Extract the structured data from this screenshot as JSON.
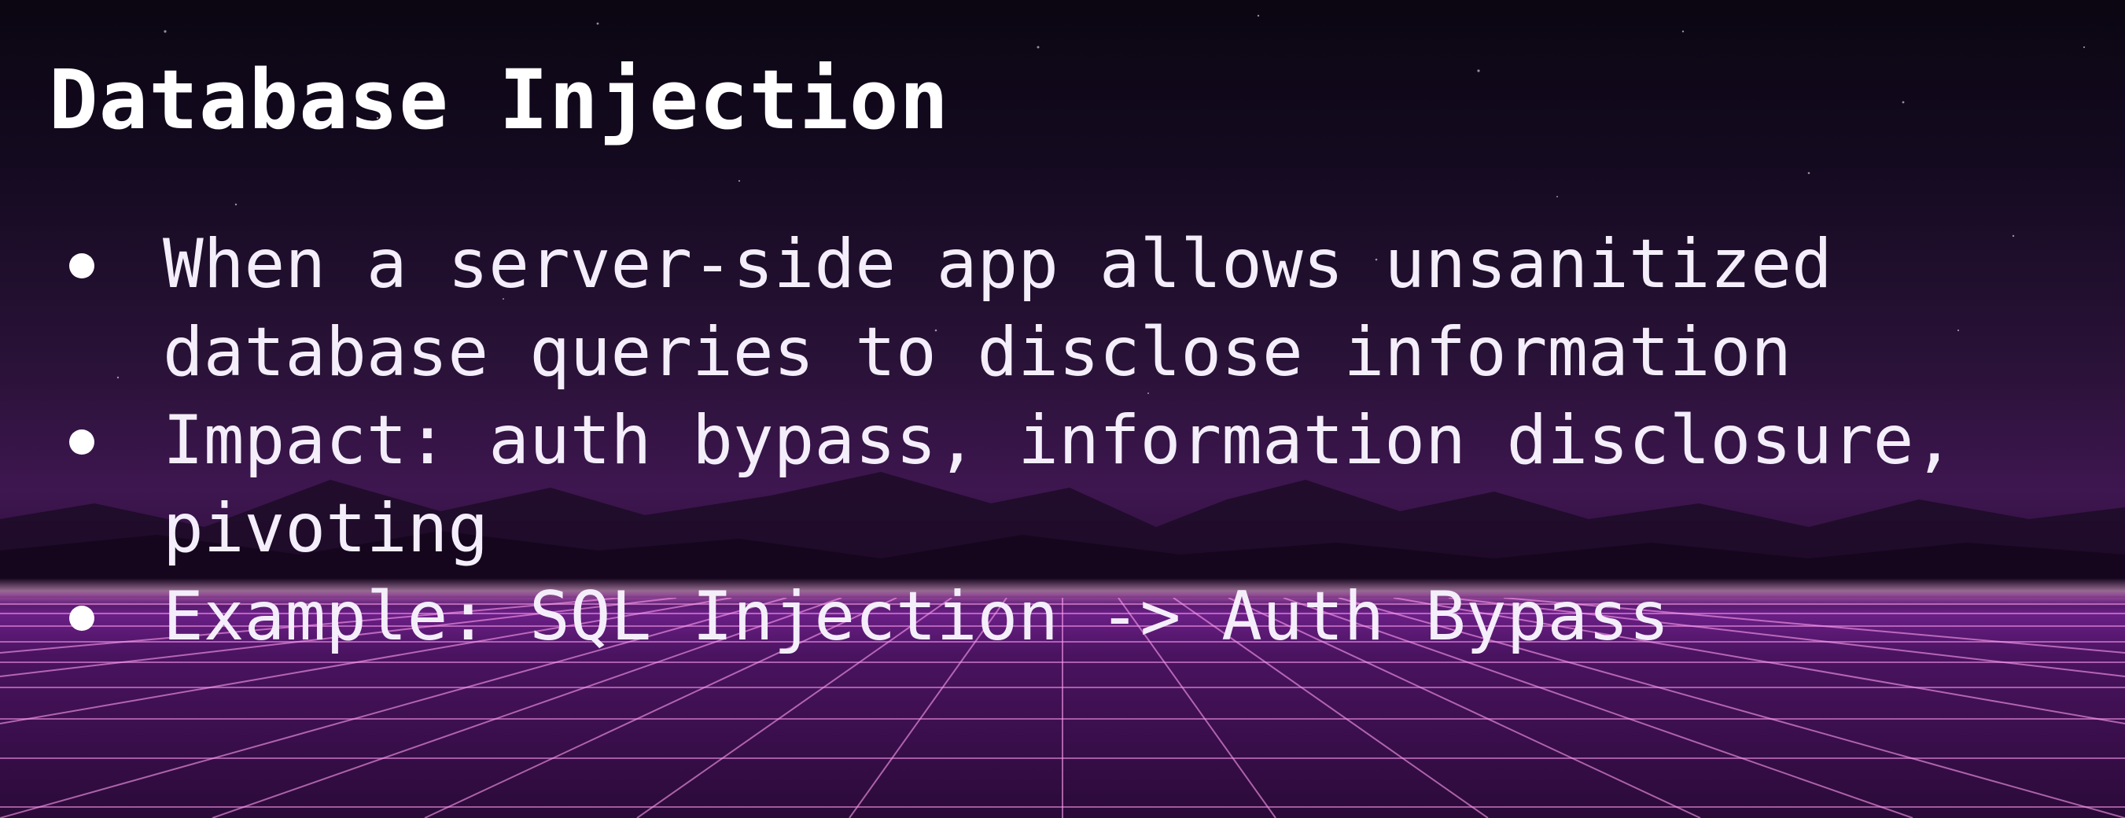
{
  "slide": {
    "title": "Database Injection",
    "bullets": [
      {
        "lines": [
          "When a server-side app allows unsanitized",
          "database queries to disclose information"
        ]
      },
      {
        "lines": [
          "Impact: auth bypass, information disclosure,",
          "pivoting"
        ]
      },
      {
        "lines": [
          "Example: SQL Injection -> Auth Bypass"
        ]
      }
    ]
  },
  "background": {
    "style": "synthwave",
    "colors": {
      "sky_top": "#0b0612",
      "sky_mid": "#2a1238",
      "horizon_glow": "#ffbef0",
      "grid_floor": "#4a1360",
      "grid_lines": "#ff9cf0",
      "mountains": "#1e0a28"
    }
  }
}
